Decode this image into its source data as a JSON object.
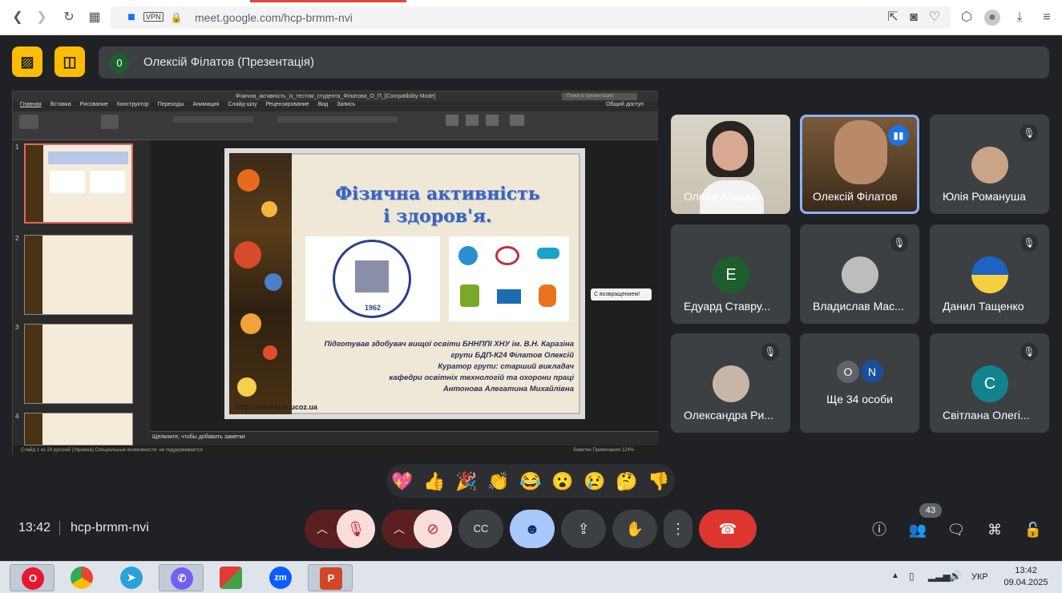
{
  "browser": {
    "url": "meet.google.com/hcp-brmm-nvi",
    "vpn_label": "VPN"
  },
  "presentation_bar": {
    "count": "0",
    "title": "Олексій Філатов (Презентація)"
  },
  "ppt": {
    "window_title": "Фізична_активність_із_тестом_студента_Філатова_О_П_[Compatibility Mode]",
    "search_placeholder": "Поиск в презентации",
    "share_label": "Общий доступ",
    "menu": [
      "Главная",
      "Вставка",
      "Рисование",
      "Конструктор",
      "Переходы",
      "Анимация",
      "Слайд-шоу",
      "Рецензирование",
      "Вид",
      "Запись"
    ],
    "thumb_numbers": [
      "1",
      "2",
      "3",
      "4"
    ],
    "notes_placeholder": "Щелкните, чтобы добавить заметки",
    "status_left": "Слайд 1 из 24    русский (Украина)    Специальные возможности: не поддерживается",
    "status_right": "Заметки    Примечания    124%",
    "chip": "С возвращением!"
  },
  "slide": {
    "title_line1": "Фізична активність",
    "title_line2": "і здоров'я.",
    "logo_year": "1962",
    "text_lines": [
      "Підготував здобувач вищої освіти БННППІ ХНУ ім. В.Н. Каразіна",
      "групи БДП-К24 Філатов Олексій",
      "Куратор групи: старший викладач",
      "кафедри освітніх технологій та охорони праці",
      "Антонова Алегатина Михайлівна"
    ],
    "url": "http://slovesnik.ucoz.ua"
  },
  "participants": [
    {
      "name": "Олена Атаєва",
      "type": "video",
      "muted": false
    },
    {
      "name": "Олексій Філатов",
      "type": "video",
      "speaking": true
    },
    {
      "name": "Юлія Романуша",
      "type": "photo",
      "muted": true
    },
    {
      "name": "Едуард Ставру...",
      "type": "initial",
      "initial": "Е",
      "color": "#1e5e2e",
      "muted": true
    },
    {
      "name": "Владислав Мас...",
      "type": "photo",
      "muted": true
    },
    {
      "name": "Данил Тащенко",
      "type": "photo",
      "muted": true
    },
    {
      "name": "Олександра Ри...",
      "type": "photo",
      "muted": true
    },
    {
      "name": "Ще 34 особи",
      "type": "group",
      "initials": [
        "O",
        "N"
      ]
    },
    {
      "name": "Світлана Олегі...",
      "type": "initial",
      "initial": "C",
      "color": "#12838e",
      "muted": true
    }
  ],
  "reactions": [
    "💖",
    "👍",
    "🎉",
    "👏",
    "😂",
    "😮",
    "😢",
    "🤔",
    "👎"
  ],
  "bottom": {
    "time": "13:42",
    "meeting_code": "hcp-brmm-nvi",
    "people_count": "43"
  },
  "taskbar": {
    "lang": "УКР",
    "time": "13:42",
    "date": "09.04.2025"
  }
}
